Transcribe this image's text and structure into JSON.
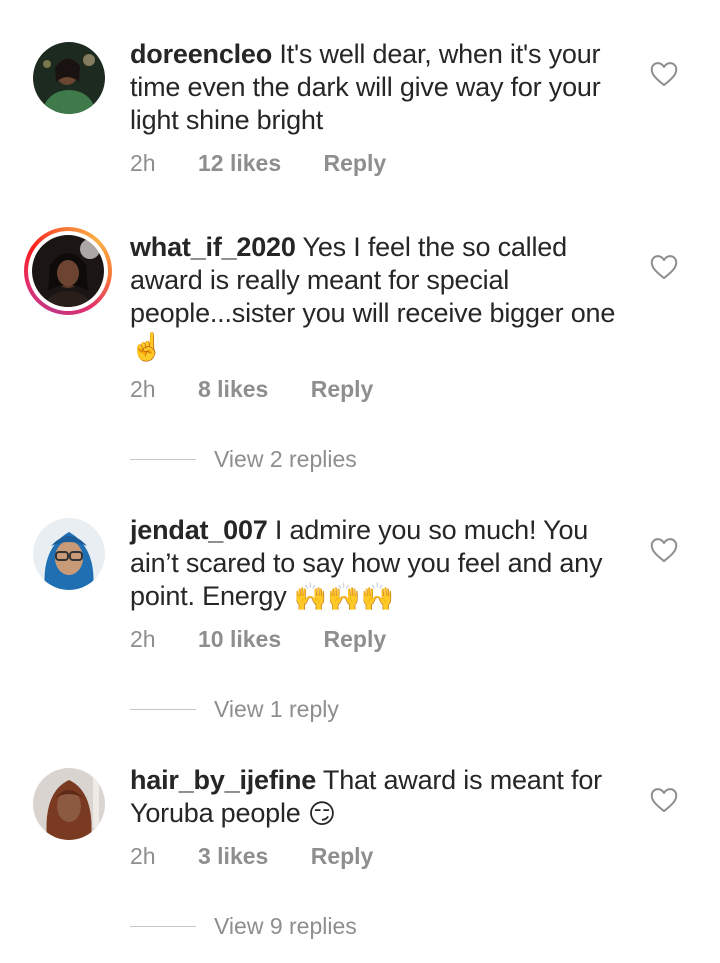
{
  "comments": [
    {
      "username": "doreencleo",
      "text": "It's well dear, when it's your time even the dark will give way for your light shine bright",
      "emoji": "",
      "time": "2h",
      "likes": "12 likes",
      "reply": "Reply",
      "story_ring": false,
      "view_replies": ""
    },
    {
      "username": "what_if_2020",
      "text": "Yes I feel the so called award is really meant for special people...sister you will receive bigger one",
      "emoji": "☝️",
      "time": "2h",
      "likes": "8 likes",
      "reply": "Reply",
      "story_ring": true,
      "view_replies": "View 2 replies"
    },
    {
      "username": "jendat_007",
      "text": "I admire you so much! You ain’t scared to say how you feel and any point. Energy",
      "emoji": "🙌🙌🙌",
      "time": "2h",
      "likes": "10 likes",
      "reply": "Reply",
      "story_ring": false,
      "view_replies": "View 1 reply"
    },
    {
      "username": "hair_by_ijefine",
      "text": "That award is meant for Yoruba people",
      "emoji": "😏",
      "time": "2h",
      "likes": "3 likes",
      "reply": "Reply",
      "story_ring": false,
      "view_replies": "View 9 replies"
    }
  ],
  "icons": {
    "like": "heart-outline-icon"
  },
  "colors": {
    "text": "#262626",
    "secondary": "#8e8e8e",
    "story_ring_start": "#c13584",
    "story_ring_end": "#fcaf45"
  }
}
